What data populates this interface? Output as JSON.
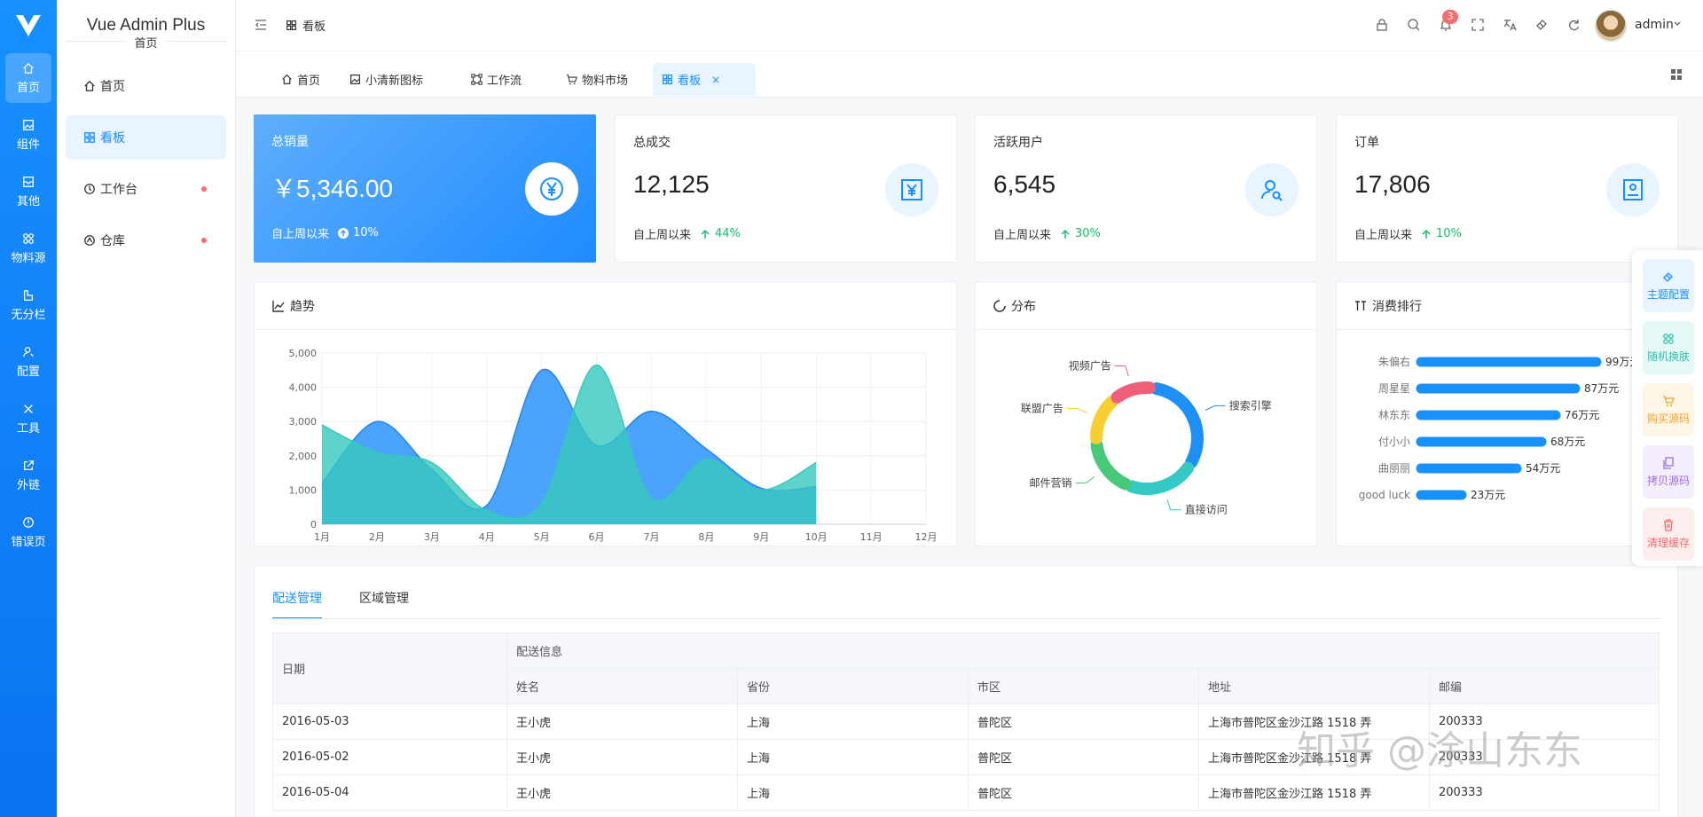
{
  "brand": {
    "title": "Vue Admin Plus",
    "subtitle": "首页"
  },
  "rail": [
    {
      "label": "首页",
      "icon": "home-icon"
    },
    {
      "label": "组件",
      "icon": "image-icon"
    },
    {
      "label": "其他",
      "icon": "inbox-icon"
    },
    {
      "label": "物料源",
      "icon": "apps-icon"
    },
    {
      "label": "无分栏",
      "icon": "layout-icon"
    },
    {
      "label": "配置",
      "icon": "user-settings-icon"
    },
    {
      "label": "工具",
      "icon": "tools-icon"
    },
    {
      "label": "外链",
      "icon": "external-link-icon"
    },
    {
      "label": "错误页",
      "icon": "error-icon"
    }
  ],
  "menu": [
    {
      "label": "首页",
      "icon": "home-icon",
      "dot": false
    },
    {
      "label": "看板",
      "icon": "dashboard-icon",
      "dot": false
    },
    {
      "label": "工作台",
      "icon": "clock-icon",
      "dot": true
    },
    {
      "label": "仓库",
      "icon": "repo-icon",
      "dot": true
    }
  ],
  "header": {
    "breadcrumb": "看板",
    "notifications": "3",
    "user": "admin"
  },
  "tabs": [
    {
      "label": "首页"
    },
    {
      "label": "小清新图标"
    },
    {
      "label": "工作流"
    },
    {
      "label": "物料市场"
    },
    {
      "label": "看板",
      "close": "×"
    }
  ],
  "stats": [
    {
      "label": "总销量",
      "value": "￥5,346.00",
      "foot": "自上周以来",
      "pct": "10%",
      "icon": "yen-circle-icon"
    },
    {
      "label": "总成交",
      "value": "12,125",
      "foot": "自上周以来",
      "pct": "44%",
      "icon": "yen-box-icon"
    },
    {
      "label": "活跃用户",
      "value": "6,545",
      "foot": "自上周以来",
      "pct": "30%",
      "icon": "user-search-icon"
    },
    {
      "label": "订单",
      "value": "17,806",
      "foot": "自上周以来",
      "pct": "10%",
      "icon": "order-icon"
    }
  ],
  "panels": {
    "trend": "趋势",
    "dist": "分布",
    "rank": "消费排行"
  },
  "chart_data": [
    {
      "type": "area",
      "title": "趋势",
      "categories": [
        "1月",
        "2月",
        "3月",
        "4月",
        "5月",
        "6月",
        "7月",
        "8月",
        "9月",
        "10月",
        "11月",
        "12月"
      ],
      "y_ticks": [
        "0",
        "1,000",
        "2,000",
        "3,000",
        "4,000",
        "5,000"
      ],
      "ylim": [
        0,
        5000
      ],
      "series": [
        {
          "values": [
            1200,
            3000,
            1600,
            550,
            4500,
            2300,
            3300,
            2200,
            1050,
            1100
          ]
        },
        {
          "values": [
            2900,
            2100,
            1800,
            400,
            600,
            4650,
            750,
            1900,
            1000,
            1800
          ]
        }
      ]
    },
    {
      "type": "pie",
      "title": "分布",
      "labels": [
        "搜索引擎",
        "直接访问",
        "邮件营销",
        "联盟广告",
        "视频广告"
      ],
      "values": [
        32,
        22,
        18,
        15,
        13
      ],
      "colors": [
        "#1d8ff5",
        "#35c9c6",
        "#48c97a",
        "#f7cf31",
        "#ee5f7a"
      ]
    },
    {
      "type": "bar",
      "title": "消费排行",
      "categories": [
        "朱偏右",
        "周星星",
        "林东东",
        "付小小",
        "曲丽丽",
        "good luck"
      ],
      "values": [
        99,
        87,
        76,
        68,
        54,
        23
      ],
      "value_labels": [
        "99万元",
        "87万元",
        "76万元",
        "68万元",
        "54万元",
        "23万元"
      ]
    }
  ],
  "floater": [
    {
      "label": "主题配置",
      "color": "#1890ff",
      "bg": "#e8f4ff"
    },
    {
      "label": "随机换肤",
      "color": "#2bc4b0",
      "bg": "#e6f8f5"
    },
    {
      "label": "购买源码",
      "color": "#f3a52b",
      "bg": "#fdf5e6"
    },
    {
      "label": "拷贝源码",
      "color": "#9b6fe0",
      "bg": "#f3edfc"
    },
    {
      "label": "清理缓存",
      "color": "#f56c6c",
      "bg": "#fdeeee"
    }
  ],
  "table": {
    "tabs": [
      "配送管理",
      "区域管理"
    ],
    "group": "配送信息",
    "headers": [
      "日期",
      "姓名",
      "省份",
      "市区",
      "地址",
      "邮编"
    ],
    "rows": [
      [
        "2016-05-03",
        "王小虎",
        "上海",
        "普陀区",
        "上海市普陀区金沙江路 1518 弄",
        "200333"
      ],
      [
        "2016-05-02",
        "王小虎",
        "上海",
        "普陀区",
        "上海市普陀区金沙江路 1518 弄",
        "200333"
      ],
      [
        "2016-05-04",
        "王小虎",
        "上海",
        "普陀区",
        "上海市普陀区金沙江路 1518 弄",
        "200333"
      ]
    ]
  },
  "watermark": "知乎 @涂山东东"
}
